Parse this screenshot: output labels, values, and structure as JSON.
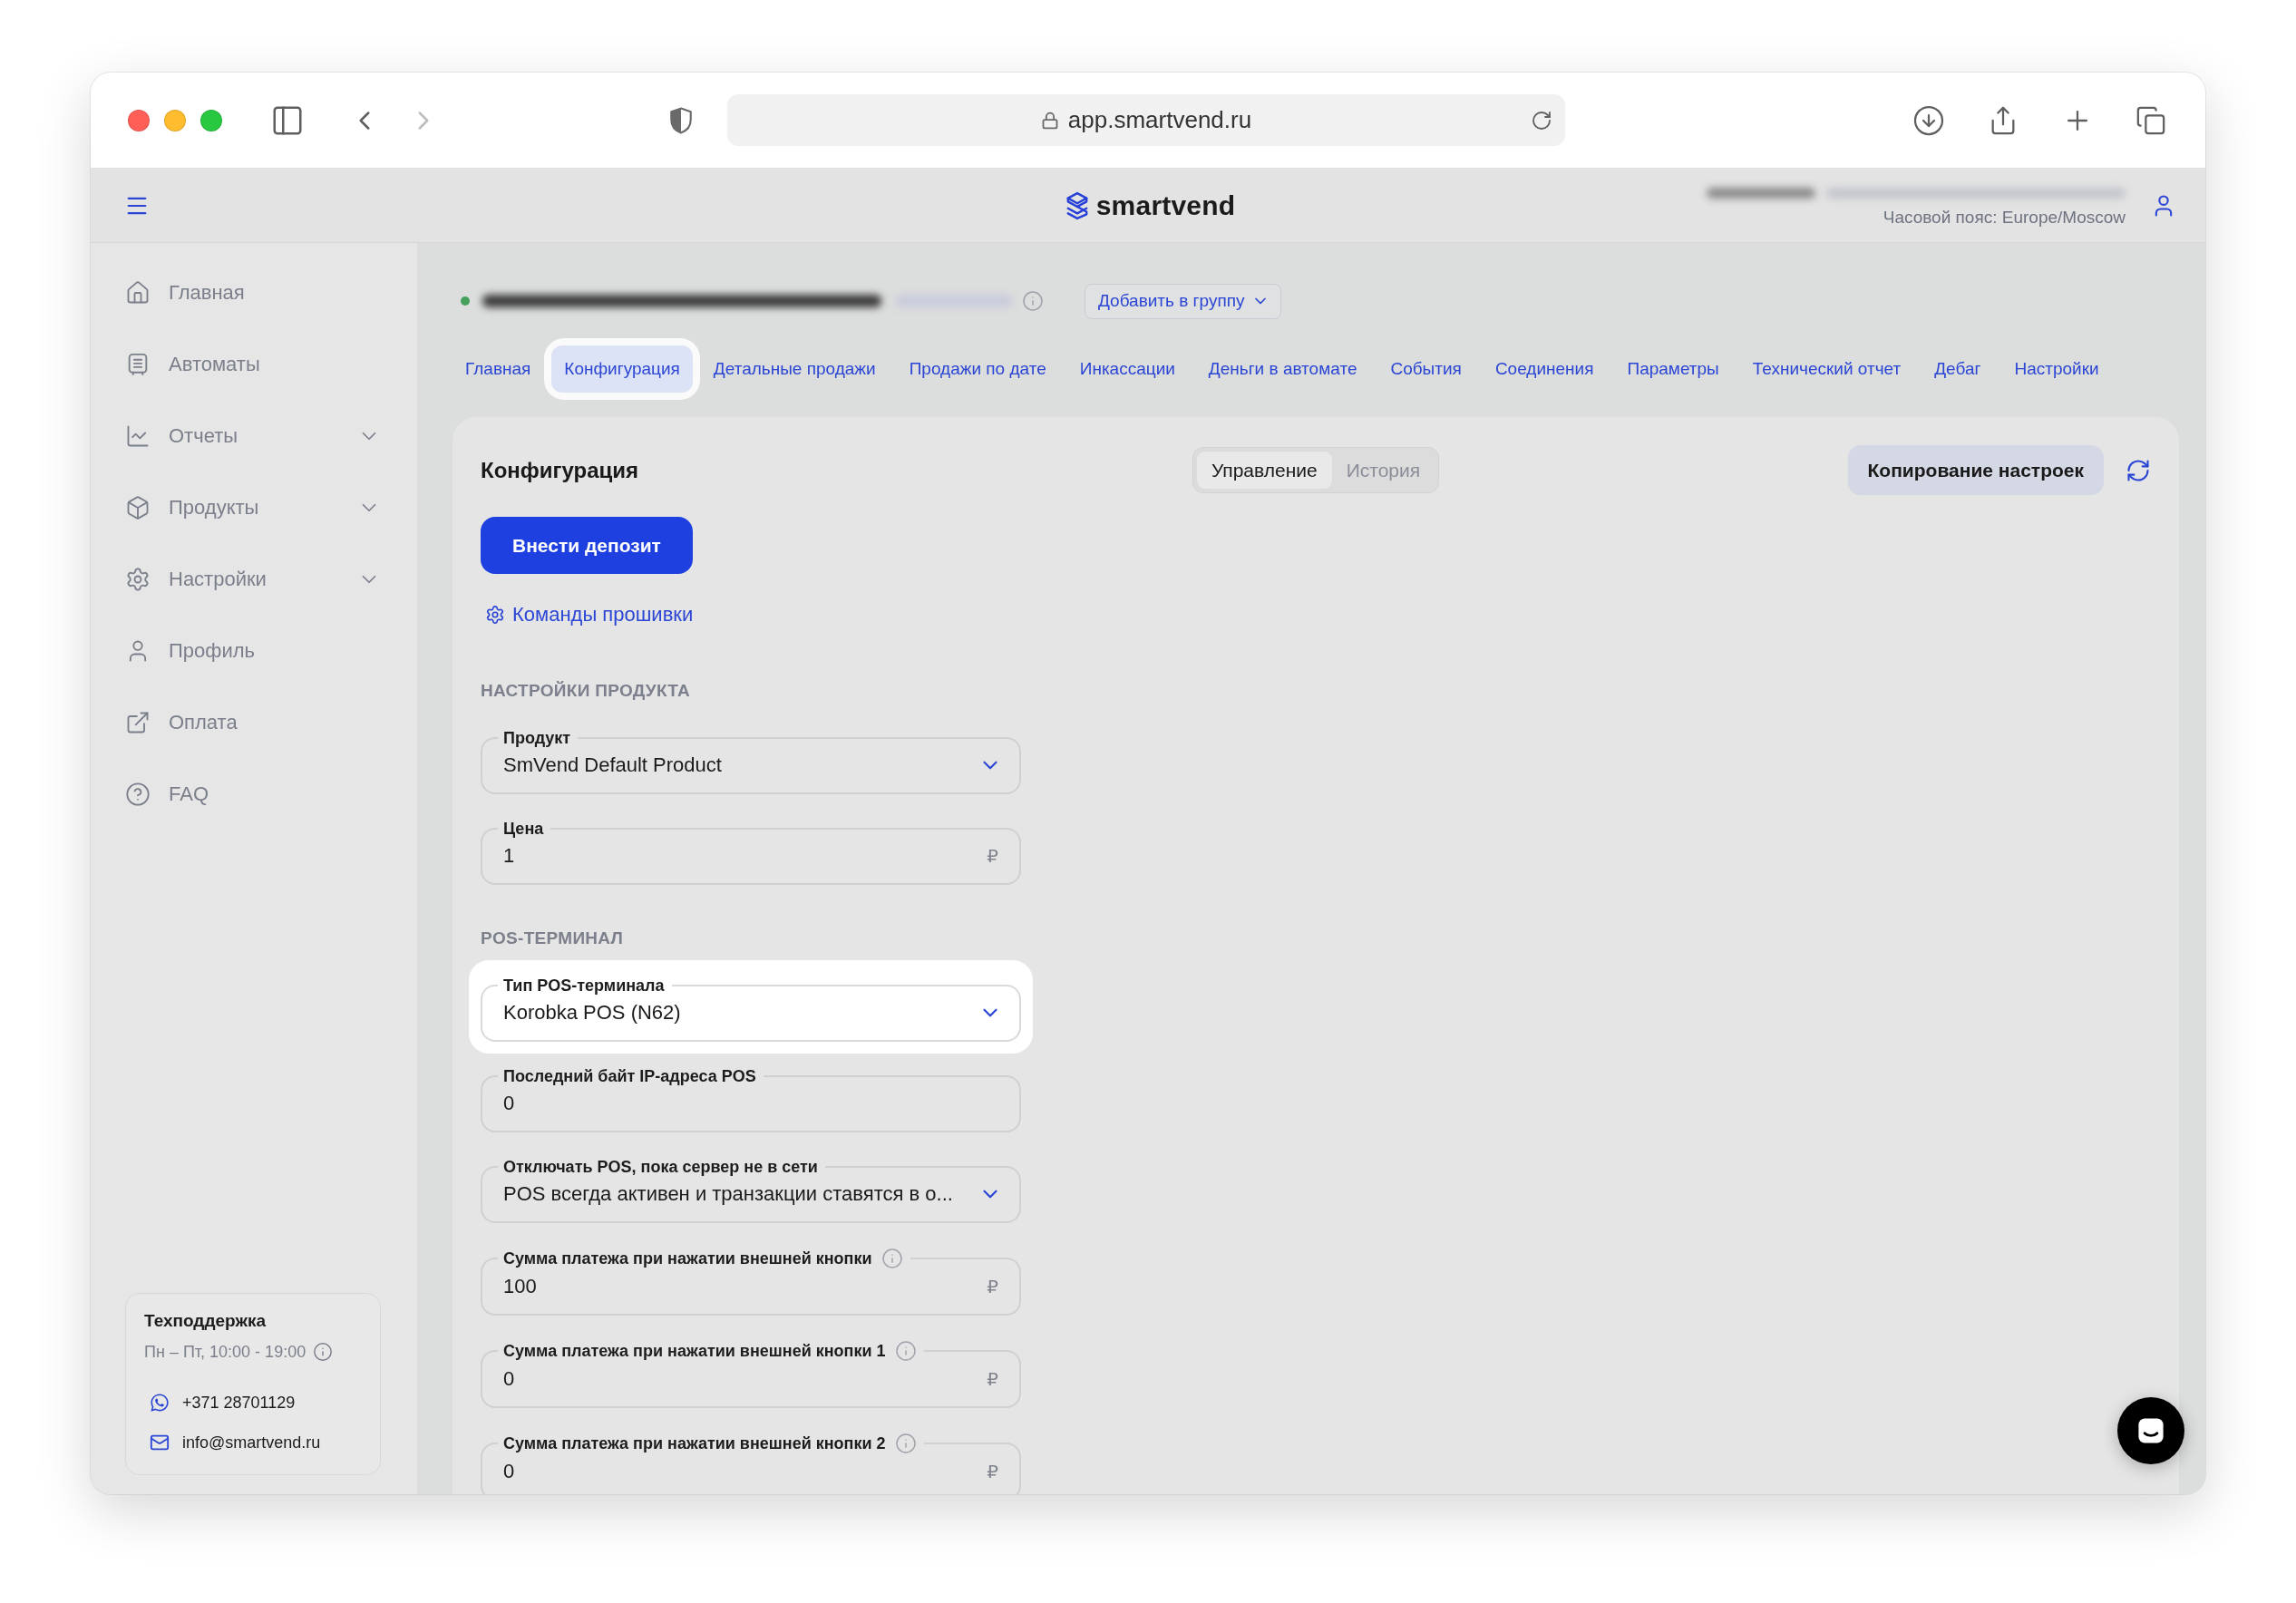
{
  "browser": {
    "url": "app.smartvend.ru"
  },
  "header": {
    "logo": "smartvend",
    "timezone": "Часовой пояс: Europe/Moscow"
  },
  "sidebar": {
    "items": [
      {
        "label": "Главная",
        "kind": "home",
        "expandable": false
      },
      {
        "label": "Автоматы",
        "kind": "machines",
        "expandable": false
      },
      {
        "label": "Отчеты",
        "kind": "reports",
        "expandable": true
      },
      {
        "label": "Продукты",
        "kind": "products",
        "expandable": true
      },
      {
        "label": "Настройки",
        "kind": "settings",
        "expandable": true
      },
      {
        "label": "Профиль",
        "kind": "profile",
        "expandable": false
      },
      {
        "label": "Оплата",
        "kind": "payment",
        "expandable": false
      },
      {
        "label": "FAQ",
        "kind": "faq",
        "expandable": false
      }
    ],
    "support": {
      "title": "Техподдержка",
      "hours": "Пн – Пт, 10:00 - 19:00",
      "contacts": [
        {
          "kind": "phone",
          "text": "+371 28701129"
        },
        {
          "kind": "email",
          "text": "info@smartvend.ru"
        }
      ]
    }
  },
  "device": {
    "online": true,
    "add_to_group": "Добавить в группу"
  },
  "tabs": [
    {
      "label": "Главная",
      "selected": false,
      "highlighted": false
    },
    {
      "label": "Конфигурация",
      "selected": true,
      "highlighted": true
    },
    {
      "label": "Детальные продажи",
      "selected": false,
      "highlighted": false
    },
    {
      "label": "Продажи по дате",
      "selected": false,
      "highlighted": false
    },
    {
      "label": "Инкассации",
      "selected": false,
      "highlighted": false
    },
    {
      "label": "Деньги в автомате",
      "selected": false,
      "highlighted": false
    },
    {
      "label": "События",
      "selected": false,
      "highlighted": false
    },
    {
      "label": "Соединения",
      "selected": false,
      "highlighted": false
    },
    {
      "label": "Параметры",
      "selected": false,
      "highlighted": false
    },
    {
      "label": "Технический отчет",
      "selected": false,
      "highlighted": false
    },
    {
      "label": "Дебаг",
      "selected": false,
      "highlighted": false
    },
    {
      "label": "Настройки",
      "selected": false,
      "highlighted": false
    }
  ],
  "configuration": {
    "title": "Конфигурация",
    "modes": [
      {
        "label": "Управление",
        "selected": true
      },
      {
        "label": "История",
        "selected": false
      }
    ],
    "copy_button": "Копирование настроек",
    "deposit_button": "Внести депозит",
    "firmware_link": "Команды прошивки",
    "sections": [
      {
        "title": "НАСТРОЙКИ ПРОДУКТА",
        "fields": [
          {
            "label": "Продукт",
            "value": "SmVend Default Product",
            "kind": "select",
            "info": false,
            "highlighted": false
          },
          {
            "label": "Цена",
            "value": "1",
            "kind": "money",
            "unit": "₽",
            "info": false,
            "highlighted": false
          }
        ]
      },
      {
        "title": "POS-ТЕРМИНАЛ",
        "fields": [
          {
            "label": "Тип POS-терминала",
            "value": "Korobka POS (N62)",
            "kind": "select",
            "info": false,
            "highlighted": true
          },
          {
            "label": "Последний байт IP-адреса POS",
            "value": "0",
            "kind": "number",
            "info": false,
            "highlighted": false
          },
          {
            "label": "Отключать POS, пока сервер не в сети",
            "value": "POS всегда активен и транзакции ставятся в о...",
            "kind": "select",
            "info": false,
            "highlighted": false
          },
          {
            "label": "Сумма платежа при нажатии внешней кнопки",
            "value": "100",
            "kind": "money",
            "unit": "₽",
            "info": true,
            "highlighted": false
          },
          {
            "label": "Сумма платежа при нажатии внешней кнопки 1",
            "value": "0",
            "kind": "money",
            "unit": "₽",
            "info": true,
            "highlighted": false
          },
          {
            "label": "Сумма платежа при нажатии внешней кнопки 2",
            "value": "0",
            "kind": "money",
            "unit": "₽",
            "info": true,
            "highlighted": false
          }
        ]
      }
    ]
  }
}
